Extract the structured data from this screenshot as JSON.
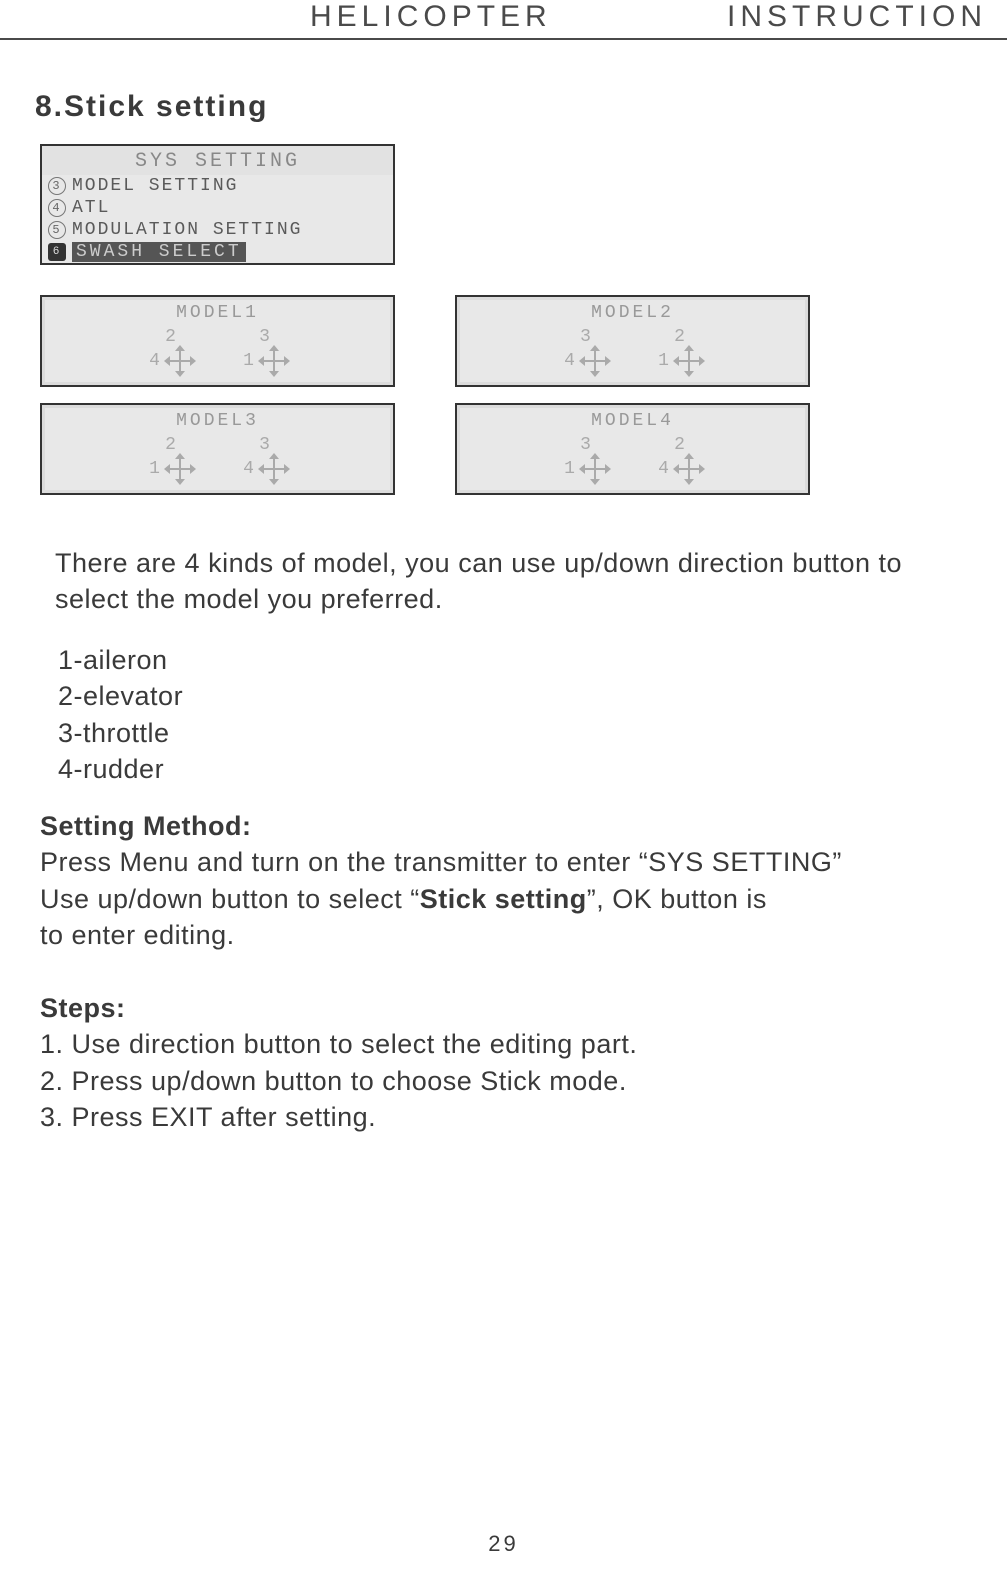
{
  "header": {
    "left": "HELICOPTER",
    "right": "INSTRUCTION"
  },
  "section_title": "8.Stick setting",
  "lcd_menu": {
    "title": "SYS SETTING",
    "items": [
      {
        "num": "3",
        "label": "MODEL SETTING",
        "selected": false
      },
      {
        "num": "4",
        "label": "ATL",
        "selected": false
      },
      {
        "num": "5",
        "label": "MODULATION SETTING",
        "selected": false
      },
      {
        "num": "6",
        "label": "SWASH SELECT",
        "selected": true
      }
    ]
  },
  "models": [
    {
      "title": "MODEL1",
      "left": {
        "top": "2",
        "side": "4"
      },
      "right": {
        "top": "3",
        "side": "1"
      }
    },
    {
      "title": "MODEL2",
      "left": {
        "top": "3",
        "side": "4"
      },
      "right": {
        "top": "2",
        "side": "1"
      }
    },
    {
      "title": "MODEL3",
      "left": {
        "top": "2",
        "side": "1"
      },
      "right": {
        "top": "3",
        "side": "4"
      }
    },
    {
      "title": "MODEL4",
      "left": {
        "top": "3",
        "side": "1"
      },
      "right": {
        "top": "2",
        "side": "4"
      }
    }
  ],
  "intro_text": "There are 4 kinds of model, you can use up/down direction button to select the model you preferred.",
  "legend": [
    "1-aileron",
    "2-elevator",
    "3-throttle",
    "4-rudder"
  ],
  "setting_method": {
    "heading": "Setting Method:",
    "line1a": "Press Menu and turn on the transmitter to enter “SYS SETTING”",
    "line2a": "Use up/down button to select “",
    "line2b_bold": "Stick setting",
    "line2c": "”, OK button is",
    "line3": "to enter editing."
  },
  "steps": {
    "heading": "Steps:",
    "items": [
      "1. Use direction button to select the editing part.",
      "2. Press up/down button to choose Stick mode.",
      "3. Press EXIT after setting."
    ]
  },
  "page_number": "29"
}
